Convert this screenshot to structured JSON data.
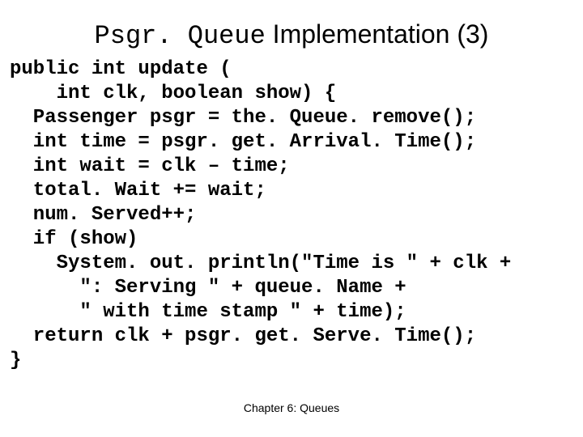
{
  "title": {
    "mono_part": "Psgr. Queue",
    "rest": " Implementation (3)"
  },
  "code_lines": [
    "public int update (",
    "    int clk, boolean show) {",
    "  Passenger psgr = the. Queue. remove();",
    "  int time = psgr. get. Arrival. Time();",
    "  int wait = clk – time;",
    "  total. Wait += wait;",
    "  num. Served++;",
    "  if (show)",
    "    System. out. println(\"Time is \" + clk +",
    "      \": Serving \" + queue. Name +",
    "      \" with time stamp \" + time);",
    "  return clk + psgr. get. Serve. Time();",
    "}"
  ],
  "footer": "Chapter 6: Queues"
}
